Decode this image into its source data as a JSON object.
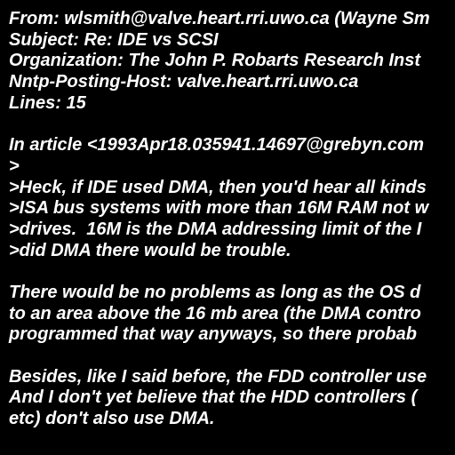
{
  "colors": {
    "background": "#000000",
    "text": "#ffffff"
  },
  "header": {
    "from": "From: wlsmith@valve.heart.rri.uwo.ca (Wayne Sm",
    "subject": "Subject: Re: IDE vs SCSI",
    "organization": "Organization: The John P. Robarts Research Inst",
    "nntp_posting_host": "Nntp-Posting-Host: valve.heart.rri.uwo.ca",
    "lines": "Lines: 15"
  },
  "body": {
    "attribution": "In article <1993Apr18.035941.14697@grebyn.com",
    "quote": [
      ">",
      ">Heck, if IDE used DMA, then you'd hear all kinds",
      ">ISA bus systems with more than 16M RAM not w",
      ">drives.  16M is the DMA addressing limit of the I",
      ">did DMA there would be trouble."
    ],
    "paragraph_1": [
      "There would be no problems as long as the OS d",
      "to an area above the 16 mb area (the DMA contro",
      "programmed that way anyways, so there probab"
    ],
    "paragraph_2": [
      "Besides, like I said before, the FDD controller use",
      "And I don't yet believe that the HDD controllers (",
      "etc) don't also use DMA."
    ]
  }
}
